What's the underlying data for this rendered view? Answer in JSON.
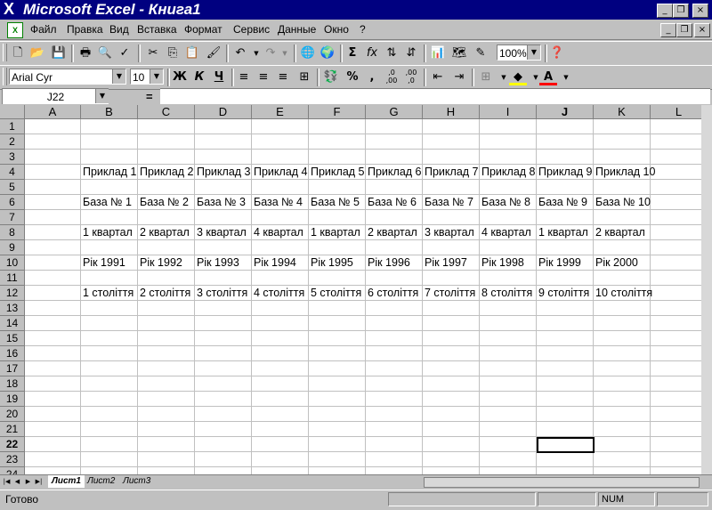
{
  "window": {
    "title": "Microsoft Excel - Книга1",
    "minimize": "_",
    "restore": "❐",
    "close": "×"
  },
  "menu": [
    {
      "label": "Файл"
    },
    {
      "label": "Правка"
    },
    {
      "label": "Вид"
    },
    {
      "label": "Вставка"
    },
    {
      "label": "Формат"
    },
    {
      "label": "Сервис"
    },
    {
      "label": "Данные"
    },
    {
      "label": "Окно"
    },
    {
      "label": "?"
    }
  ],
  "toolbar_standard": {
    "zoom": "100%",
    "icons": [
      "new-icon",
      "open-icon",
      "save-icon",
      "print-icon",
      "print-preview-icon",
      "spelling-icon",
      "cut-icon",
      "copy-icon",
      "paste-icon",
      "format-painter-icon",
      "undo-icon",
      "redo-icon",
      "hyperlink-icon",
      "web-icon",
      "autosum-icon",
      "function-icon",
      "sort-asc-icon",
      "sort-desc-icon",
      "chart-wizard-icon",
      "map-icon",
      "drawing-icon",
      "help-icon"
    ]
  },
  "toolbar_formatting": {
    "font": "Arial Cyr",
    "size": "10",
    "bold": "Ж",
    "italic": "К",
    "underline": "Ч",
    "percent": "%",
    "comma": ",",
    "inc_decimal": ",0 ,00",
    "dec_decimal": ",00 ,0"
  },
  "formula_bar": {
    "name_box": "J22",
    "equals": "=",
    "value": ""
  },
  "columns": [
    "A",
    "B",
    "C",
    "D",
    "E",
    "F",
    "G",
    "H",
    "I",
    "J",
    "K",
    "L"
  ],
  "rows": [
    "1",
    "2",
    "3",
    "4",
    "5",
    "6",
    "7",
    "8",
    "9",
    "10",
    "11",
    "12",
    "13",
    "14",
    "15",
    "16",
    "17",
    "18",
    "19",
    "20",
    "21",
    "22",
    "23",
    "24"
  ],
  "active_cell": {
    "col": "J",
    "row": "22"
  },
  "cells": {
    "row4": [
      "Приклад 1",
      "Приклад 2",
      "Приклад 3",
      "Приклад 4",
      "Приклад 5",
      "Приклад 6",
      "Приклад 7",
      "Приклад 8",
      "Приклад 9",
      "Приклад 10"
    ],
    "row6": [
      "База № 1",
      "База № 2",
      "База № 3",
      "База № 4",
      "База № 5",
      "База № 6",
      "База № 7",
      "База № 8",
      "База № 9",
      "База № 10"
    ],
    "row8": [
      "1 квартал",
      "2 квартал",
      "3 квартал",
      "4 квартал",
      "1 квартал",
      "2 квартал",
      "3 квартал",
      "4 квартал",
      "1 квартал",
      "2 квартал"
    ],
    "row10": [
      "Рік 1991",
      "Рік 1992",
      "Рік 1993",
      "Рік 1994",
      "Рік 1995",
      "Рік 1996",
      "Рік 1997",
      "Рік 1998",
      "Рік 1999",
      "Рік 2000"
    ],
    "row12": [
      "1 століття",
      "2 століття",
      "3 століття",
      "4 століття",
      "5 століття",
      "6 століття",
      "7 століття",
      "8 століття",
      "9 століття",
      "10 століття"
    ]
  },
  "sheets": [
    {
      "label": "Лист1",
      "active": true
    },
    {
      "label": "Лист2",
      "active": false
    },
    {
      "label": "Лист3",
      "active": false
    }
  ],
  "status": {
    "ready": "Готово",
    "num": "NUM"
  }
}
